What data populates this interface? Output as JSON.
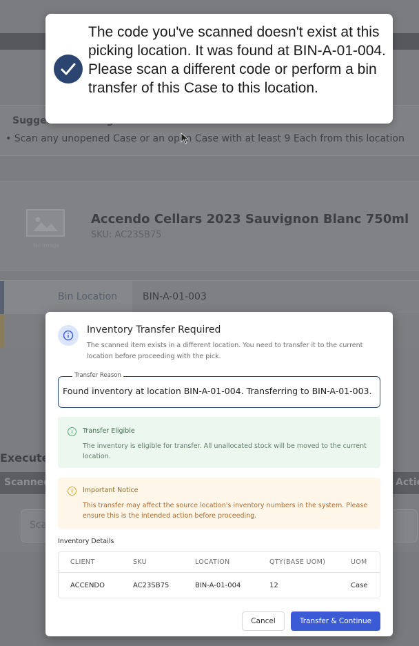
{
  "background": {
    "suggestion_title": "Suggested Picking Path",
    "suggestion_line": "•  Scan any unopened Case or an open Case with at least 9 Each from this location",
    "product_name": "Accendo Cellars 2023 Sauvignon Blanc 750ml",
    "product_sku": "SKU: AC23SB75",
    "image_placeholder": "No image",
    "bin_location_label": "Bin Location",
    "bin_location_value": "BIN-A-01-003",
    "execute_title": "Execute",
    "table_header_left": "Scanned",
    "table_header_right": "Actions",
    "scan_placeholder": "Scan"
  },
  "toast": {
    "message": "The code you've scanned doesn't exist at this picking location. It was found at BIN-A-01-004. Please scan a different code or perform a bin transfer of this Case to this location."
  },
  "modal": {
    "title": "Inventory Transfer Required",
    "description": "The scanned item exists in a different location. You need to transfer it to the current location before proceeding with the pick.",
    "transfer_reason_label": "Transfer Reason",
    "transfer_reason_value": "Found inventory at location BIN-A-01-004. Transferring to BIN-A-01-003.",
    "eligible_title": "Transfer Eligible",
    "eligible_text": "The inventory is eligible for transfer. All unallocated stock will be moved to the current location.",
    "notice_title": "Important Notice",
    "notice_text": "This transfer may affect the source location's inventory numbers in the system. Please ensure this is the intended action before proceeding.",
    "inventory_details_title": "Inventory Details",
    "table": {
      "headers": [
        "CLIENT",
        "SKU",
        "LOCATION",
        "QTY(BASE UOM)",
        "UOM"
      ],
      "rows": [
        [
          "ACCENDO",
          "AC23SB75",
          "BIN-A-01-004",
          "12",
          "Case"
        ]
      ]
    },
    "cancel_label": "Cancel",
    "confirm_label": "Transfer & Continue"
  },
  "colors": {
    "primary_button": "#3b5bd6",
    "toast_check": "#2b4470",
    "eligible_bg": "#ebf7ef",
    "notice_bg": "#fdf6e9"
  }
}
